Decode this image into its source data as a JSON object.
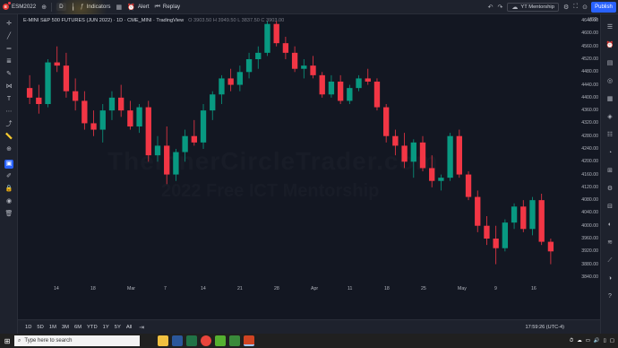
{
  "topbar": {
    "symbol": "ESM2022",
    "symbol_badge": "E",
    "interval": "D",
    "indicators": "Indicators",
    "alert": "Alert",
    "replay": "Replay",
    "yt": "YT Mentorship",
    "publish": "Publish"
  },
  "chart": {
    "title": "E-MINI S&P 500 FUTURES (JUN 2022) · 1D · CME_MINI · TradingView",
    "ohlc_text": "O 3903.50  H 3949.50  L 3837.50  C 3903.00",
    "currency": "USD",
    "watermark_line1": "TheInnerCircleTrader.com",
    "watermark_line2": "2022 Free ICT Mentorship",
    "price_ticks": [
      "4640.00",
      "4600.00",
      "4560.00",
      "4520.00",
      "4480.00",
      "4440.00",
      "4400.00",
      "4360.00",
      "4320.00",
      "4280.00",
      "4240.00",
      "4200.00",
      "4160.00",
      "4120.00",
      "4080.00",
      "4040.00",
      "4000.00",
      "3960.00",
      "3920.00",
      "3880.00",
      "3840.00"
    ],
    "date_ticks": [
      "14",
      "18",
      "Mar",
      "7",
      "14",
      "21",
      "28",
      "Apr",
      "11",
      "18",
      "25",
      "May",
      "9",
      "16"
    ],
    "bull_color": "#089981",
    "bear_color": "#f23645"
  },
  "chart_data": {
    "type": "candlestick",
    "ylim": [
      3820,
      4660
    ],
    "ohlc": [
      [
        4430,
        4470,
        4380,
        4400
      ],
      [
        4400,
        4440,
        4350,
        4380
      ],
      [
        4380,
        4520,
        4370,
        4510
      ],
      [
        4510,
        4560,
        4480,
        4500
      ],
      [
        4500,
        4540,
        4400,
        4420
      ],
      [
        4420,
        4460,
        4360,
        4390
      ],
      [
        4390,
        4420,
        4300,
        4320
      ],
      [
        4320,
        4360,
        4280,
        4300
      ],
      [
        4300,
        4380,
        4260,
        4360
      ],
      [
        4360,
        4420,
        4330,
        4400
      ],
      [
        4400,
        4440,
        4340,
        4360
      ],
      [
        4360,
        4390,
        4300,
        4310
      ],
      [
        4310,
        4380,
        4290,
        4370
      ],
      [
        4370,
        4390,
        4200,
        4220
      ],
      [
        4220,
        4280,
        4200,
        4250
      ],
      [
        4250,
        4310,
        4130,
        4160
      ],
      [
        4160,
        4240,
        4140,
        4230
      ],
      [
        4230,
        4300,
        4200,
        4280
      ],
      [
        4280,
        4330,
        4250,
        4260
      ],
      [
        4260,
        4380,
        4240,
        4360
      ],
      [
        4360,
        4420,
        4330,
        4410
      ],
      [
        4410,
        4470,
        4380,
        4460
      ],
      [
        4460,
        4490,
        4420,
        4440
      ],
      [
        4440,
        4500,
        4420,
        4480
      ],
      [
        4480,
        4540,
        4460,
        4520
      ],
      [
        4520,
        4560,
        4490,
        4540
      ],
      [
        4540,
        4640,
        4530,
        4630
      ],
      [
        4630,
        4640,
        4560,
        4570
      ],
      [
        4570,
        4590,
        4520,
        4540
      ],
      [
        4540,
        4560,
        4480,
        4490
      ],
      [
        4490,
        4520,
        4460,
        4500
      ],
      [
        4500,
        4530,
        4460,
        4470
      ],
      [
        4470,
        4480,
        4400,
        4410
      ],
      [
        4410,
        4470,
        4400,
        4450
      ],
      [
        4450,
        4470,
        4380,
        4390
      ],
      [
        4390,
        4440,
        4380,
        4430
      ],
      [
        4430,
        4470,
        4420,
        4460
      ],
      [
        4460,
        4490,
        4440,
        4450
      ],
      [
        4450,
        4460,
        4360,
        4370
      ],
      [
        4370,
        4380,
        4260,
        4280
      ],
      [
        4280,
        4300,
        4220,
        4250
      ],
      [
        4250,
        4290,
        4180,
        4200
      ],
      [
        4200,
        4270,
        4150,
        4260
      ],
      [
        4260,
        4280,
        4170,
        4180
      ],
      [
        4180,
        4220,
        4120,
        4140
      ],
      [
        4140,
        4160,
        4110,
        4150
      ],
      [
        4150,
        4290,
        4140,
        4280
      ],
      [
        4280,
        4300,
        4150,
        4160
      ],
      [
        4160,
        4170,
        4080,
        4090
      ],
      [
        4090,
        4110,
        3980,
        4000
      ],
      [
        4000,
        4030,
        3940,
        3960
      ],
      [
        3960,
        4000,
        3880,
        3930
      ],
      [
        3930,
        4020,
        3920,
        4010
      ],
      [
        4010,
        4070,
        3990,
        4060
      ],
      [
        4060,
        4080,
        3980,
        3990
      ],
      [
        3990,
        4090,
        3970,
        4080
      ],
      [
        4080,
        4100,
        3940,
        3950
      ],
      [
        3950,
        3960,
        3880,
        3920
      ]
    ]
  },
  "bottombar": {
    "ranges": [
      "1D",
      "5D",
      "1M",
      "3M",
      "6M",
      "YTD",
      "1Y",
      "5Y",
      "All"
    ],
    "clock": "17:59:26 (UTC-4)"
  },
  "taskbar": {
    "search_placeholder": "Type here to search"
  }
}
